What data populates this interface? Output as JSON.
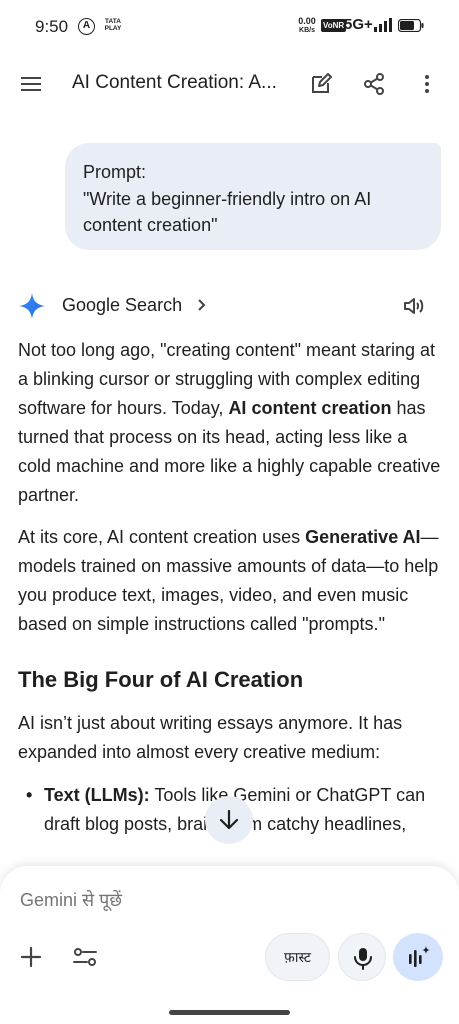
{
  "status_bar": {
    "time": "9:50",
    "carrier_icon_letter": "A",
    "tataplay_line1": "TATA",
    "tataplay_line2": "PLAY",
    "speed_value": "0.00",
    "speed_unit": "KB/s",
    "volte": "VoNR",
    "network": "5G+"
  },
  "app_bar": {
    "title": "AI Content Creation: A...",
    "icons": [
      "menu-icon",
      "edit-icon",
      "share-icon",
      "more-vert-icon"
    ]
  },
  "prompt": {
    "line1": "Prompt:",
    "line2": "\"Write a beginner-friendly intro on AI",
    "line3": "content creation\""
  },
  "response": {
    "source_label": "Google Search",
    "p1_before": "Not too long ago, \"creating content\" meant staring at a blinking cursor or struggling with complex editing software for hours. Today, ",
    "p1_bold": "AI content creation",
    "p1_after": " has turned that process on its head, acting less like a cold machine and more like a highly capable creative partner.",
    "p2_before": "At its core, AI content creation uses ",
    "p2_bold": "Generative AI",
    "p2_after": "—models trained on massive amounts of data—to help you produce text, images, video, and even music based on simple instructions called \"prompts.\"",
    "heading": "The Big Four of AI Creation",
    "p3": "AI isn’t just about writing essays anymore. It has expanded into almost every creative medium:",
    "bullet1_bold": "Text (LLMs):",
    "bullet1_text": " Tools like Gemini or ChatGPT can draft blog posts, brainstorm catchy headlines,"
  },
  "composer": {
    "placeholder": "Gemini से पूछें",
    "mode_label": "फ़ास्ट",
    "icons": [
      "add-icon",
      "tools-icon",
      "mic-icon",
      "live-icon"
    ]
  },
  "colors": {
    "bubble_bg": "#e9eef6",
    "live_btn_bg": "#d3e3fd",
    "spark_blue": "#4285f4"
  }
}
